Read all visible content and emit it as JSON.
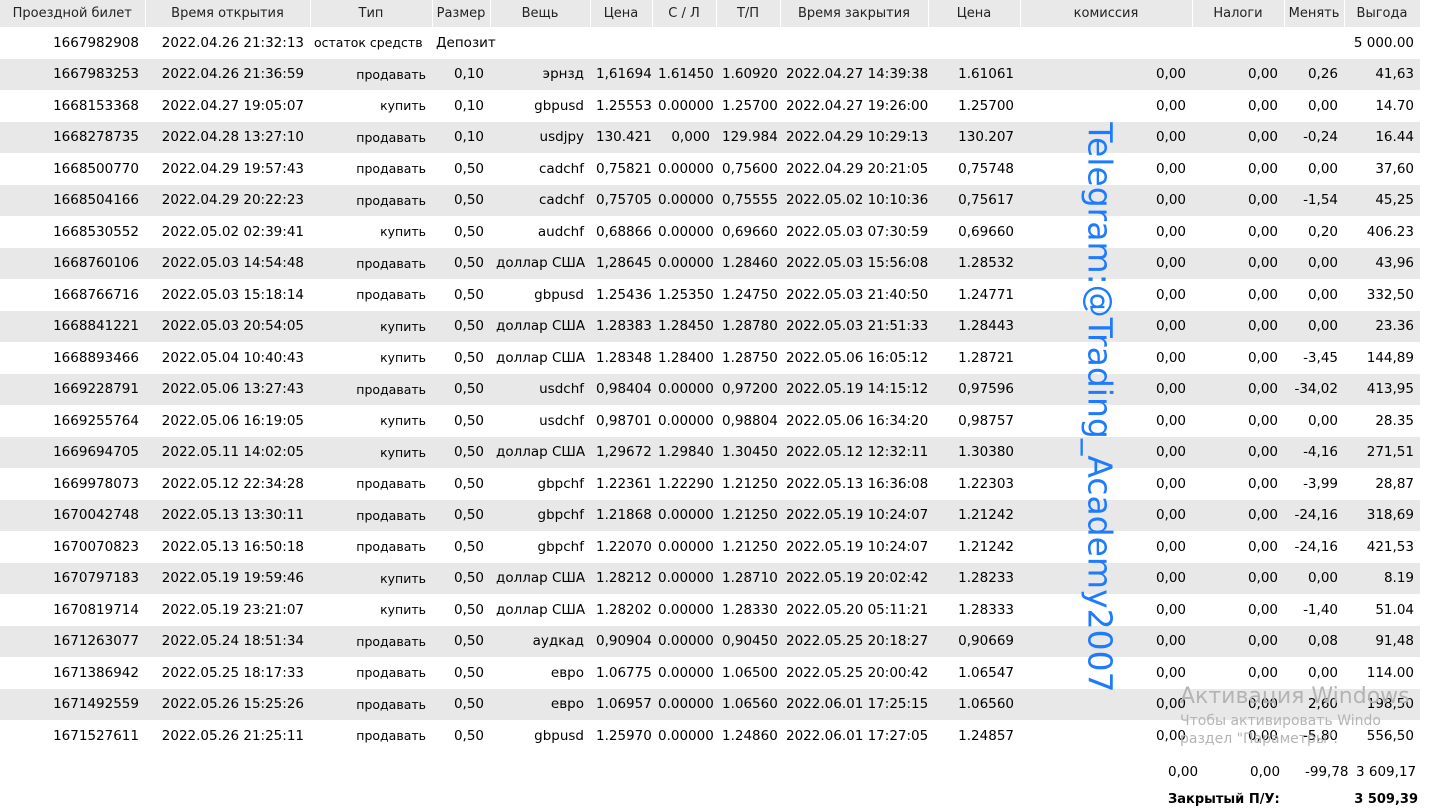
{
  "headers": [
    "Проездной билет",
    "Время открытия",
    "Тип",
    "Размер",
    "Вещь",
    "Цена",
    "С / Л",
    "Т/П",
    "Время закрытия",
    "Цена",
    "комиссия",
    "Налоги",
    "Менять",
    "Выгода"
  ],
  "deposit": {
    "ticket": "1667982908",
    "time": "2022.04.26 21:32:13",
    "type": "остаток средств",
    "label": "Депозит",
    "profit": "5 000.00"
  },
  "rows": [
    [
      "1667983253",
      "2022.04.26 21:36:59",
      "продавать",
      "0,10",
      "эрнзд",
      "1,61694",
      "1.61450",
      "1.60920",
      "2022.04.27 14:39:38",
      "1.61061",
      "0,00",
      "0,00",
      "0,26",
      "41,63"
    ],
    [
      "1668153368",
      "2022.04.27 19:05:07",
      "купить",
      "0,10",
      "gbpusd",
      "1.25553",
      "0.00000",
      "1.25700",
      "2022.04.27 19:26:00",
      "1.25700",
      "0,00",
      "0,00",
      "0,00",
      "14.70"
    ],
    [
      "1668278735",
      "2022.04.28 13:27:10",
      "продавать",
      "0,10",
      "usdjpy",
      "130.421",
      "0,000",
      "129.984",
      "2022.04.29 10:29:13",
      "130.207",
      "0,00",
      "0,00",
      "-0,24",
      "16.44"
    ],
    [
      "1668500770",
      "2022.04.29 19:57:43",
      "продавать",
      "0,50",
      "cadchf",
      "0,75821",
      "0.00000",
      "0,75600",
      "2022.04.29 20:21:05",
      "0,75748",
      "0,00",
      "0,00",
      "0,00",
      "37,60"
    ],
    [
      "1668504166",
      "2022.04.29 20:22:23",
      "продавать",
      "0,50",
      "cadchf",
      "0,75705",
      "0.00000",
      "0,75555",
      "2022.05.02 10:10:36",
      "0,75617",
      "0,00",
      "0,00",
      "-1,54",
      "45,25"
    ],
    [
      "1668530552",
      "2022.05.02 02:39:41",
      "купить",
      "0,50",
      "audchf",
      "0,68866",
      "0.00000",
      "0,69660",
      "2022.05.03 07:30:59",
      "0,69660",
      "0,00",
      "0,00",
      "0,20",
      "406.23"
    ],
    [
      "1668760106",
      "2022.05.03 14:54:48",
      "продавать",
      "0,50",
      "доллар США",
      "1,28645",
      "0.00000",
      "1.28460",
      "2022.05.03 15:56:08",
      "1.28532",
      "0,00",
      "0,00",
      "0,00",
      "43,96"
    ],
    [
      "1668766716",
      "2022.05.03 15:18:14",
      "продавать",
      "0,50",
      "gbpusd",
      "1.25436",
      "1.25350",
      "1.24750",
      "2022.05.03 21:40:50",
      "1.24771",
      "0,00",
      "0,00",
      "0,00",
      "332,50"
    ],
    [
      "1668841221",
      "2022.05.03 20:54:05",
      "купить",
      "0,50",
      "доллар США",
      "1.28383",
      "1.28450",
      "1.28780",
      "2022.05.03 21:51:33",
      "1.28443",
      "0,00",
      "0,00",
      "0,00",
      "23.36"
    ],
    [
      "1668893466",
      "2022.05.04 10:40:43",
      "купить",
      "0,50",
      "доллар США",
      "1.28348",
      "1.28400",
      "1.28750",
      "2022.05.06 16:05:12",
      "1.28721",
      "0,00",
      "0,00",
      "-3,45",
      "144,89"
    ],
    [
      "1669228791",
      "2022.05.06 13:27:43",
      "продавать",
      "0,50",
      "usdchf",
      "0,98404",
      "0.00000",
      "0,97200",
      "2022.05.19 14:15:12",
      "0,97596",
      "0,00",
      "0,00",
      "-34,02",
      "413,95"
    ],
    [
      "1669255764",
      "2022.05.06 16:19:05",
      "купить",
      "0,50",
      "usdchf",
      "0,98701",
      "0.00000",
      "0,98804",
      "2022.05.06 16:34:20",
      "0,98757",
      "0,00",
      "0,00",
      "0,00",
      "28.35"
    ],
    [
      "1669694705",
      "2022.05.11 14:02:05",
      "купить",
      "0,50",
      "доллар США",
      "1,29672",
      "1.29840",
      "1.30450",
      "2022.05.12 12:32:11",
      "1.30380",
      "0,00",
      "0,00",
      "-4,16",
      "271,51"
    ],
    [
      "1669978073",
      "2022.05.12 22:34:28",
      "продавать",
      "0,50",
      "gbpchf",
      "1.22361",
      "1.22290",
      "1.21250",
      "2022.05.13 16:36:08",
      "1.22303",
      "0,00",
      "0,00",
      "-3,99",
      "28,87"
    ],
    [
      "1670042748",
      "2022.05.13 13:30:11",
      "продавать",
      "0,50",
      "gbpchf",
      "1.21868",
      "0.00000",
      "1.21250",
      "2022.05.19 10:24:07",
      "1.21242",
      "0,00",
      "0,00",
      "-24,16",
      "318,69"
    ],
    [
      "1670070823",
      "2022.05.13 16:50:18",
      "продавать",
      "0,50",
      "gbpchf",
      "1.22070",
      "0.00000",
      "1.21250",
      "2022.05.19 10:24:07",
      "1.21242",
      "0,00",
      "0,00",
      "-24,16",
      "421,53"
    ],
    [
      "1670797183",
      "2022.05.19 19:59:46",
      "купить",
      "0,50",
      "доллар США",
      "1.28212",
      "0.00000",
      "1.28710",
      "2022.05.19 20:02:42",
      "1.28233",
      "0,00",
      "0,00",
      "0,00",
      "8.19"
    ],
    [
      "1670819714",
      "2022.05.19 23:21:07",
      "купить",
      "0,50",
      "доллар США",
      "1.28202",
      "0.00000",
      "1.28330",
      "2022.05.20 05:11:21",
      "1.28333",
      "0,00",
      "0,00",
      "-1,40",
      "51.04"
    ],
    [
      "1671263077",
      "2022.05.24 18:51:34",
      "продавать",
      "0,50",
      "аудкад",
      "0,90904",
      "0.00000",
      "0,90450",
      "2022.05.25 20:18:27",
      "0,90669",
      "0,00",
      "0,00",
      "0,08",
      "91,48"
    ],
    [
      "1671386942",
      "2022.05.25 18:17:33",
      "продавать",
      "0,50",
      "евро",
      "1.06775",
      "0.00000",
      "1.06500",
      "2022.05.25 20:00:42",
      "1.06547",
      "0,00",
      "0,00",
      "0,00",
      "114.00"
    ],
    [
      "1671492559",
      "2022.05.26 15:25:26",
      "продавать",
      "0,50",
      "евро",
      "1.06957",
      "0.00000",
      "1.06560",
      "2022.06.01 17:25:15",
      "1.06560",
      "0,00",
      "0,00",
      "2,60",
      "198,50"
    ],
    [
      "1671527611",
      "2022.05.26 21:25:11",
      "продавать",
      "0,50",
      "gbpusd",
      "1.25970",
      "0.00000",
      "1.24860",
      "2022.06.01 17:27:05",
      "1.24857",
      "0,00",
      "0,00",
      "-5,80",
      "556,50"
    ]
  ],
  "summary": {
    "commission": "0,00",
    "taxes": "0,00",
    "swap": "-99,78",
    "profit": "3 609,17"
  },
  "closed_pl": {
    "label": "Закрытый П/У:",
    "value": "3 509,39"
  },
  "watermark": "Telegram:@Trading_Academy2007",
  "windows_activation": {
    "title": "Активация Windows",
    "line1": "Чтобы активировать Windo",
    "line2": "раздел \"Параметры\"."
  }
}
